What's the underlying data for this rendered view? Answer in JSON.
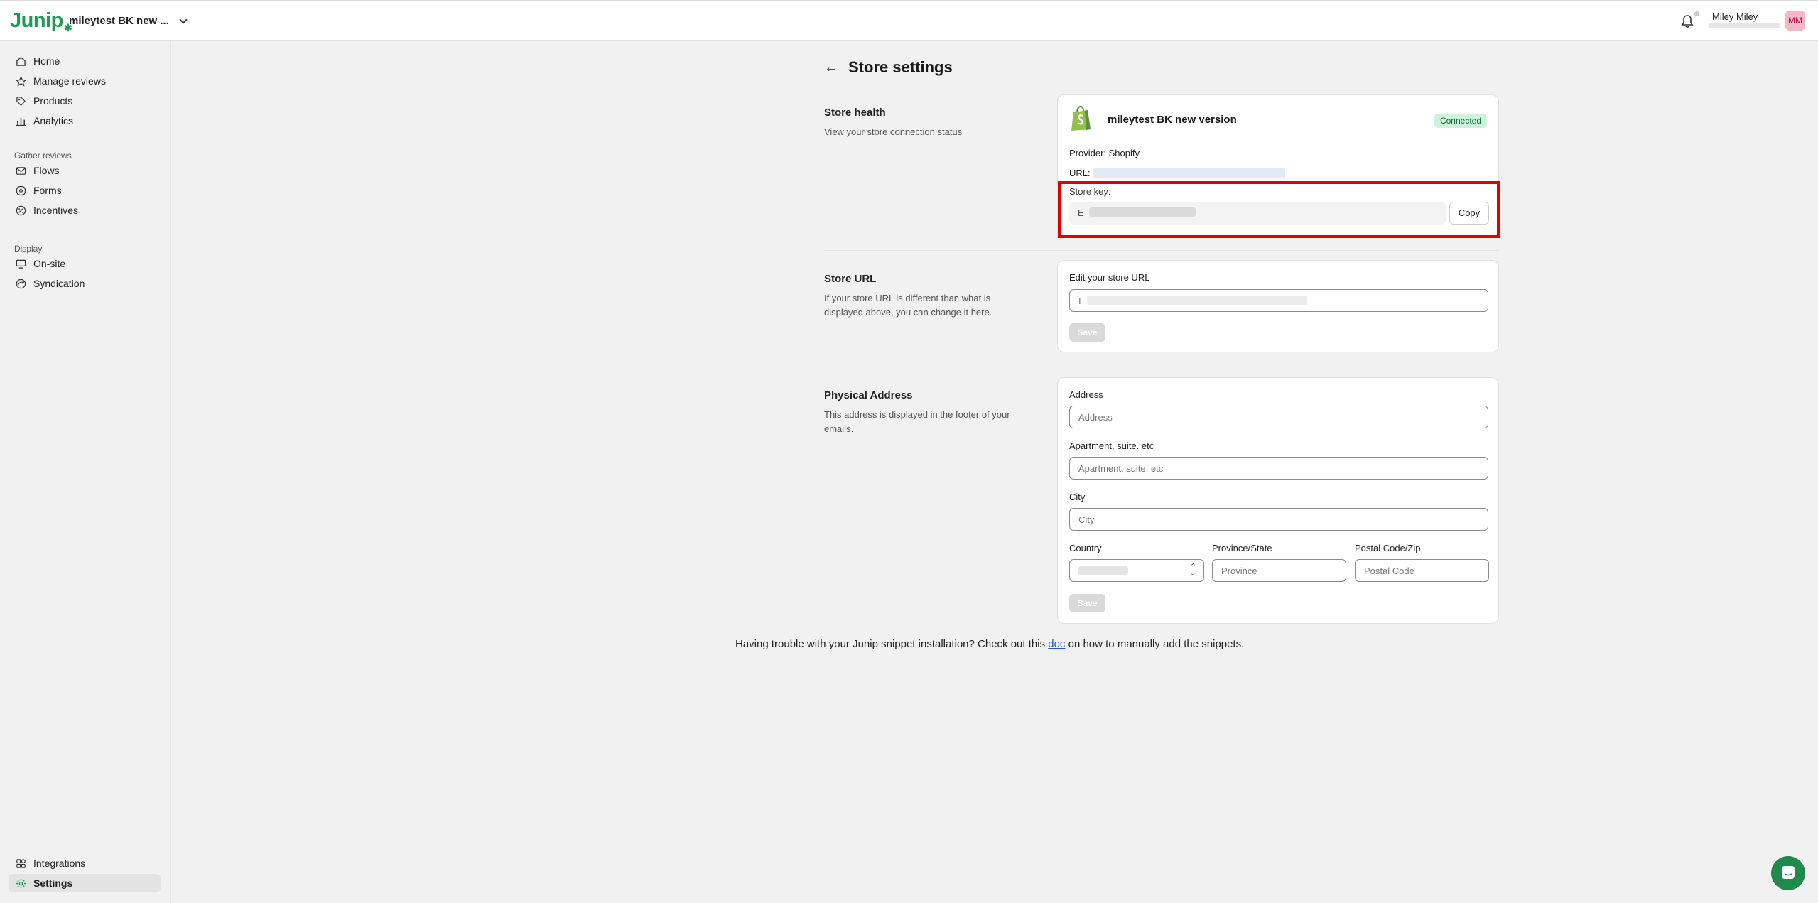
{
  "header": {
    "logo": "Junip",
    "store_switcher": "mileytest BK new ...",
    "user_name": "Miley Miley",
    "avatar_initials": "MM"
  },
  "sidebar": {
    "items_top": [
      {
        "label": "Home",
        "icon": "home-icon"
      },
      {
        "label": "Manage reviews",
        "icon": "star-icon"
      },
      {
        "label": "Products",
        "icon": "tag-icon"
      },
      {
        "label": "Analytics",
        "icon": "bar-chart-icon"
      }
    ],
    "gather_title": "Gather reviews",
    "items_gather": [
      {
        "label": "Flows",
        "icon": "mail-icon"
      },
      {
        "label": "Forms",
        "icon": "forms-icon"
      },
      {
        "label": "Incentives",
        "icon": "incentive-icon"
      }
    ],
    "display_title": "Display",
    "items_display": [
      {
        "label": "On-site",
        "icon": "monitor-icon"
      },
      {
        "label": "Syndication",
        "icon": "syndication-icon"
      }
    ],
    "items_bottom": [
      {
        "label": "Integrations",
        "icon": "integrations-icon"
      },
      {
        "label": "Settings",
        "icon": "gear-icon",
        "active": true
      }
    ]
  },
  "page": {
    "title": "Store settings"
  },
  "store_health": {
    "title": "Store health",
    "description": "View your store connection status",
    "store_name": "mileytest BK new version",
    "status": "Connected",
    "provider": "Provider: Shopify",
    "url_label": "URL:",
    "store_key_label": "Store key:",
    "store_key_prefix": "E",
    "copy_label": "Copy"
  },
  "store_url": {
    "title": "Store URL",
    "description": "If your store URL is different than what is displayed above, you can change it here.",
    "field_label": "Edit your store URL",
    "value_prefix": "I",
    "save_label": "Save"
  },
  "physical_address": {
    "title": "Physical Address",
    "description": "This address is displayed in the footer of your emails.",
    "address_label": "Address",
    "address_placeholder": "Address",
    "apartment_label": "Apartment, suite. etc",
    "apartment_placeholder": "Apartment, suite. etc",
    "city_label": "City",
    "city_placeholder": "City",
    "country_label": "Country",
    "province_label": "Province/State",
    "province_placeholder": "Province",
    "postal_label": "Postal Code/Zip",
    "postal_placeholder": "Postal Code",
    "save_label": "Save"
  },
  "footer": {
    "before": "Having trouble with your Junip snippet installation? Check out this ",
    "link": "doc",
    "after": " on how to manually add the snippets."
  },
  "colors": {
    "brand_green": "#1f9b55",
    "highlight_red": "#e00000",
    "connected_bg": "#cdf3dc",
    "link_blue": "#1e5bc6"
  }
}
